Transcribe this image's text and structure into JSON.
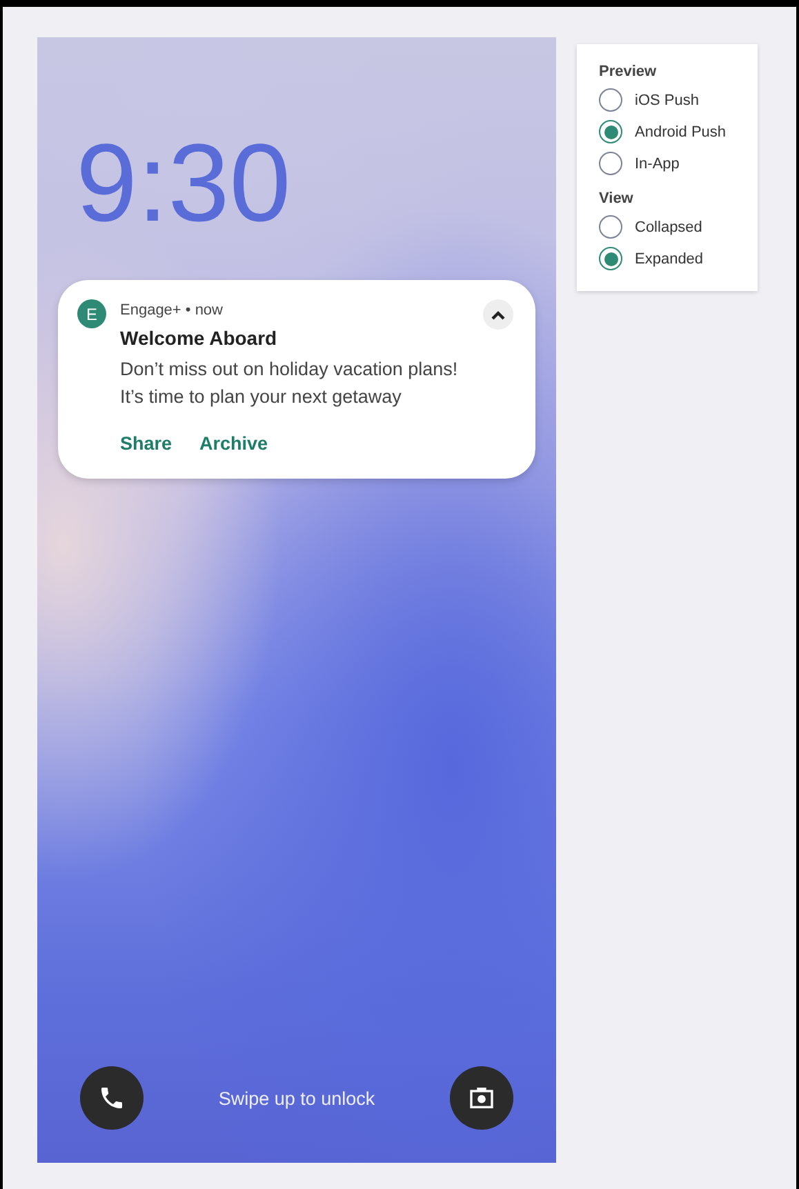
{
  "lock_screen": {
    "clock": "9:30",
    "notification": {
      "app_initial": "E",
      "meta": "Engage+ • now",
      "expanded": true,
      "title": "Welcome Aboard",
      "body_lines": [
        "Don’t miss out on holiday vacation plans!",
        "It’s time to plan your next getaway"
      ],
      "actions": [
        "Share",
        "Archive"
      ]
    },
    "hint": "Swipe up to unlock"
  },
  "settings": {
    "groups": [
      {
        "heading": "Preview",
        "options": [
          {
            "label": "iOS Push",
            "selected": false
          },
          {
            "label": "Android Push",
            "selected": true
          },
          {
            "label": "In-App",
            "selected": false
          }
        ]
      },
      {
        "heading": "View",
        "options": [
          {
            "label": "Collapsed",
            "selected": false
          },
          {
            "label": "Expanded",
            "selected": true
          }
        ]
      }
    ]
  }
}
